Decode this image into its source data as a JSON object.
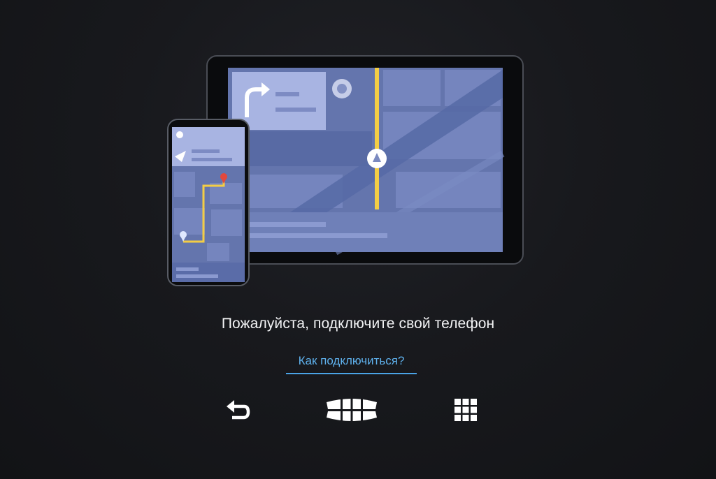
{
  "message": {
    "title": "Пожалуйста, подключите свой телефон",
    "help_link": "Как подключиться?"
  },
  "nav": {
    "back_icon": "back-arrow-icon",
    "home_icon": "brand-logo-icon",
    "apps_icon": "app-grid-icon"
  },
  "colors": {
    "background": "#17181c",
    "link": "#5fb2ee",
    "map_fill": "#6475ad",
    "route": "#f3cd45",
    "destination_pin": "#e2483c"
  }
}
